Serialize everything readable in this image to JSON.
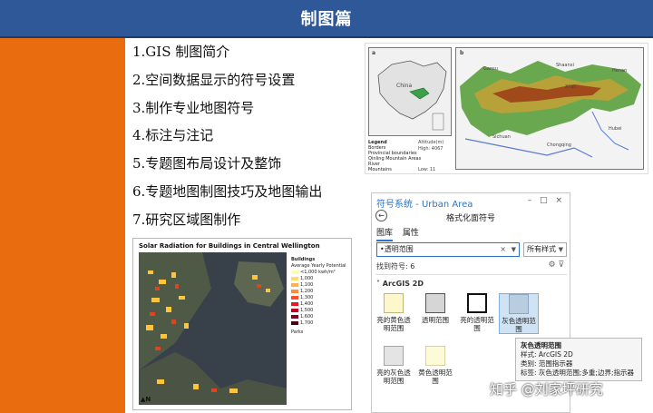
{
  "header": {
    "title": "制图篇"
  },
  "menu": {
    "items": [
      "1.GIS 制图简介",
      "2.空间数据显示的符号设置",
      "3.制作专业地图符号",
      "4.标注与注记",
      "5.专题图布局设计及整饰",
      "6.专题地图制图技巧及地图输出",
      "7.研究区域图制作"
    ]
  },
  "map_panel": {
    "inset_label": "a",
    "main_label": "b",
    "inset_country": "China",
    "legend_title": "Legend",
    "legend": [
      "Borders",
      "Provincial boundaries",
      "Qinling Mountain Areas",
      "River",
      "Mountains"
    ],
    "elev_title": "Altitude(m)",
    "elev_high": "High: 4067",
    "elev_low": "Low: 11",
    "ticks_top": [
      "80°E",
      "100°E",
      "120°E",
      "105°E",
      "110°E"
    ],
    "places": [
      "Gansu",
      "Shaanxi",
      "Henan",
      "Sichuan",
      "Hubei",
      "Chongqing",
      "Xi'an"
    ]
  },
  "arcgis": {
    "title": "符号系统 - Urban Area",
    "window_controls": "– □ ×",
    "subtitle": "格式化面符号",
    "tabs": [
      "图库",
      "属性"
    ],
    "search_value": "•透明范围",
    "style_value": "所有样式",
    "found_label": "找到符号:  6",
    "group_label": "ArcGIS 2D",
    "symbols": [
      {
        "label": "亮的黄色透明范围",
        "fill": "#fff7cc",
        "border": "#bdb77a"
      },
      {
        "label": "透明范围",
        "fill": "#d6d6d6",
        "border": "#555555"
      },
      {
        "label": "亮的透明范围",
        "fill": "#ffffff",
        "border": "#111111"
      },
      {
        "label": "灰色透明范围",
        "fill": "#b9cde0",
        "border": "#8aa8c6"
      },
      {
        "label": "亮的灰色透明范围",
        "fill": "#e4e4e4",
        "border": "#a5a5a5"
      },
      {
        "label": "黄色透明范围",
        "fill": "#fdfad8",
        "border": "#d9d3a1"
      }
    ]
  },
  "tooltip": {
    "title": "灰色透明范围",
    "line1": "样式: ArcGIS 2D",
    "line2": "类别: 范围指示器",
    "line3": "标签: 灰色透明范围;多重;边界;指示器"
  },
  "solar": {
    "title": "Solar Radiation for Buildings in Central Wellington",
    "legend_title": "Buildings",
    "legend_sub": "Average Yearly Potential",
    "legend_items": [
      "<1,000 kwh/m²",
      "1,000",
      "1,100",
      "1,200",
      "1,300",
      "1,400",
      "1,500",
      "1,600",
      "1,700"
    ],
    "legend_colors": [
      "#ffffb2",
      "#fed976",
      "#feb24c",
      "#fd8d3c",
      "#fc4e2a",
      "#e31a1c",
      "#bd0026",
      "#800026",
      "#4a0013"
    ],
    "parks_label": "Parks",
    "north": "N"
  },
  "watermark": "知乎 @刘家坪研究"
}
